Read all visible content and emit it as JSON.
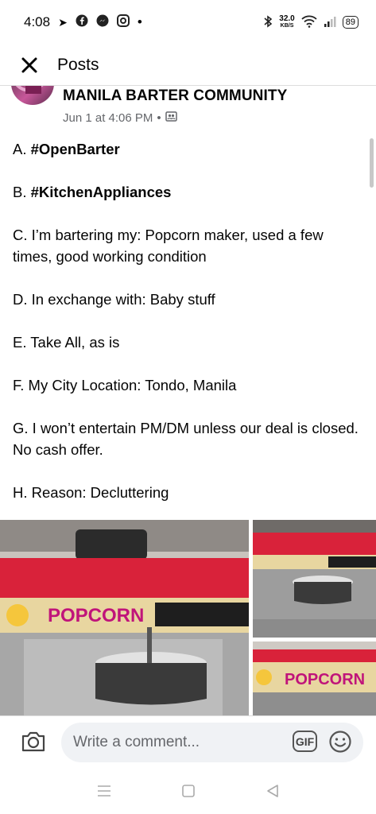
{
  "status_bar": {
    "time": "4:08",
    "speed_value": "32.0",
    "speed_unit": "KB/S",
    "battery": "89"
  },
  "header": {
    "title": "Posts"
  },
  "post": {
    "group_name": "MANILA BARTER COMMUNITY",
    "timestamp": "Jun 1 at 4:06 PM",
    "separator": "•",
    "lines": {
      "a_prefix": "A. ",
      "a_tag": "#OpenBarter",
      "b_prefix": "B. ",
      "b_tag": "#KitchenAppliances",
      "c": "C. I’m bartering my: Popcorn maker, used a few times, good working condition",
      "d": "D. In exchange with: Baby stuff",
      "e": "E. Take All, as is",
      "f": "F. My City Location: Tondo, Manila",
      "g": "G. I won’t entertain PM/DM unless our deal is closed. No cash offer.",
      "h": "H. Reason: Decluttering"
    }
  },
  "photos": {
    "brand_text": "POPCORN"
  },
  "comment_bar": {
    "placeholder": "Write a comment...",
    "gif_label": "GIF"
  },
  "icons": {
    "close": "close-icon",
    "audience": "members-icon",
    "camera": "camera-icon",
    "emoji": "emoji-icon",
    "nav_menu": "recent-apps-icon",
    "nav_home": "home-icon",
    "nav_back": "back-icon"
  },
  "colors": {
    "machine_red": "#d9223a",
    "muted_text": "#65676b",
    "input_bg": "#f0f2f5"
  }
}
